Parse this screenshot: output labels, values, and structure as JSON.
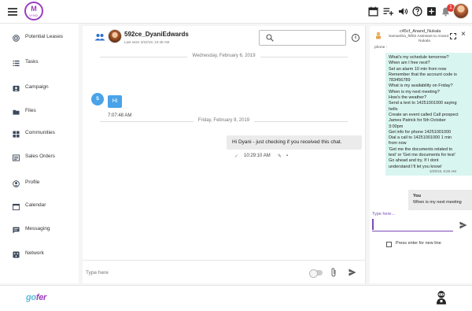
{
  "app": {
    "logo_text": "M",
    "logo_sub": "VIND"
  },
  "topbar": {
    "icons": [
      "calendar-icon",
      "playlist-add-icon",
      "volume-icon",
      "help-icon",
      "add-box-icon",
      "notifications-icon"
    ],
    "notification_count": "1"
  },
  "sidebar": {
    "items": [
      {
        "label": "Potential Leases",
        "icon": "target-icon"
      },
      {
        "label": "Tasks",
        "icon": "list-icon"
      },
      {
        "label": "Campaign",
        "icon": "contact-card-icon"
      },
      {
        "label": "Files",
        "icon": "folder-icon"
      },
      {
        "label": "Communities",
        "icon": "grid-icon"
      },
      {
        "label": "Sales Orders",
        "icon": "receipt-icon"
      },
      {
        "label": "Profile",
        "icon": "person-icon"
      },
      {
        "label": "Calendar",
        "icon": "calendar-icon"
      },
      {
        "label": "Messaging",
        "icon": "chat-icon"
      },
      {
        "label": "Network",
        "icon": "network-icon"
      }
    ]
  },
  "chat": {
    "contact_name": "592ce_DyaniEdwards",
    "last_seen": "Last seen 3/22/19, 10:45 AM",
    "search_placeholder": "",
    "dates": [
      "Wednesday, February 6, 2019",
      "Friday, February 8, 2019"
    ],
    "incoming": {
      "avatar_text": "5",
      "text": "Hi",
      "time": "7:07:48 AM"
    },
    "outgoing": {
      "text": "Hi Dyani - just checking if you received this chat.",
      "time": "10:29:10 AM"
    },
    "composer_placeholder": "Type here"
  },
  "assistant": {
    "name": "c45cf_Anand_Nukala",
    "subtitle_1": "Samantha_f6f02 Assistant to Anand",
    "subtitle_2": "Nukala",
    "phone_label": "phone :",
    "bot_lines": [
      "What's my schedule tomorrow?",
      "When am I free next?",
      "Set an alarm 10 min from now",
      "Remember that the account code is",
      "783456789",
      "What is my availability on Friday?",
      "When is my next meeting?",
      "How's the weather?",
      "Send a text to 14251001000 saying",
      "hello",
      "Create an event called Call prospect",
      "James Patrick for 5th October",
      "3:00pm",
      "Get info for phone 14251001000",
      "Dial a call to 14251001000 1 min",
      "from now",
      "'Get me the documents related to",
      "test' or 'Get me documents for test'",
      "Go ahead and try. If I dont",
      "understand I'll let you know!"
    ],
    "bot_meta": "3/29/19, 6:50 AM",
    "you_label": "You",
    "you_message": "When is my next meeting",
    "type_label": "Type here...",
    "enter_label": "Press enter for new line"
  },
  "footer": {
    "brand_g": "go",
    "brand_rest": "fer"
  },
  "colors": {
    "brand_purple": "#9b3dbf",
    "accent_blue": "#4aa3e8",
    "bot_bubble": "#d9f5ef",
    "out_bubble": "#ebebeb"
  }
}
